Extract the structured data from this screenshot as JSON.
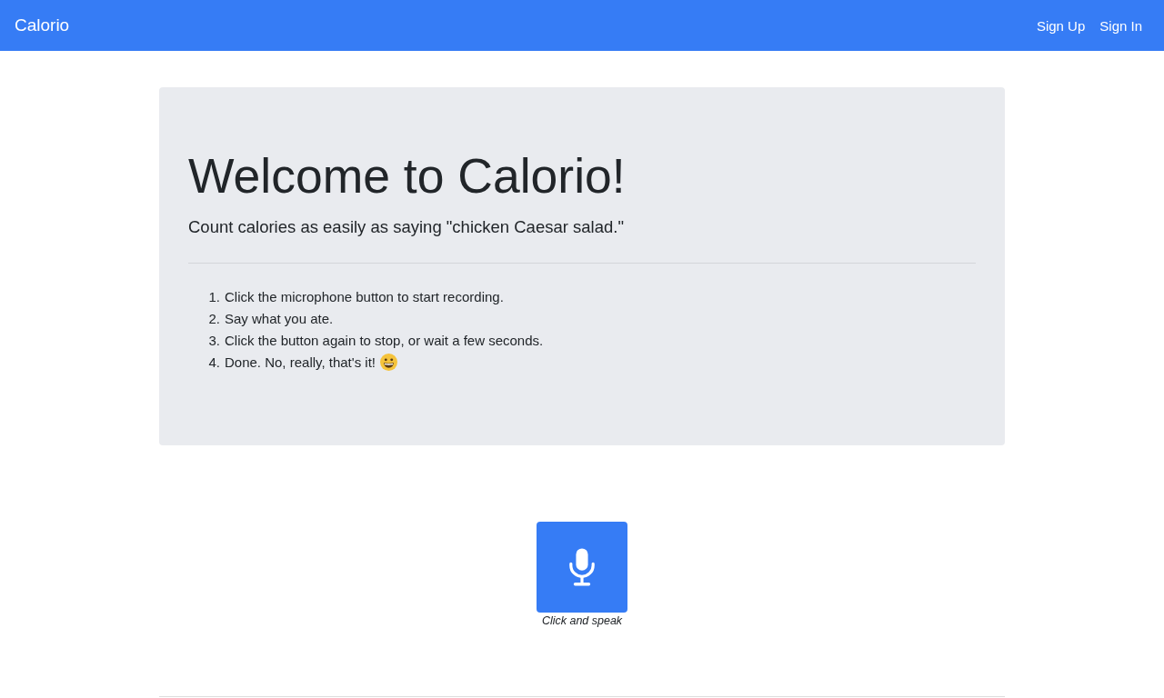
{
  "navbar": {
    "brand": "Calorio",
    "links": [
      {
        "label": "Sign Up"
      },
      {
        "label": "Sign In"
      }
    ]
  },
  "hero": {
    "title": "Welcome to Calorio!",
    "lead": "Count calories as easily as saying \"chicken Caesar salad.\"",
    "steps": [
      {
        "number": "1.",
        "text": "Click the microphone button to start recording.",
        "emoji": false
      },
      {
        "number": "2.",
        "text": "Say what you ate.",
        "emoji": false
      },
      {
        "number": "3.",
        "text": "Click the button again to stop, or wait a few seconds.",
        "emoji": false
      },
      {
        "number": "4.",
        "text": "Done. No, really, that's it!",
        "emoji": true
      }
    ]
  },
  "recorder": {
    "caption": "Click and speak"
  }
}
